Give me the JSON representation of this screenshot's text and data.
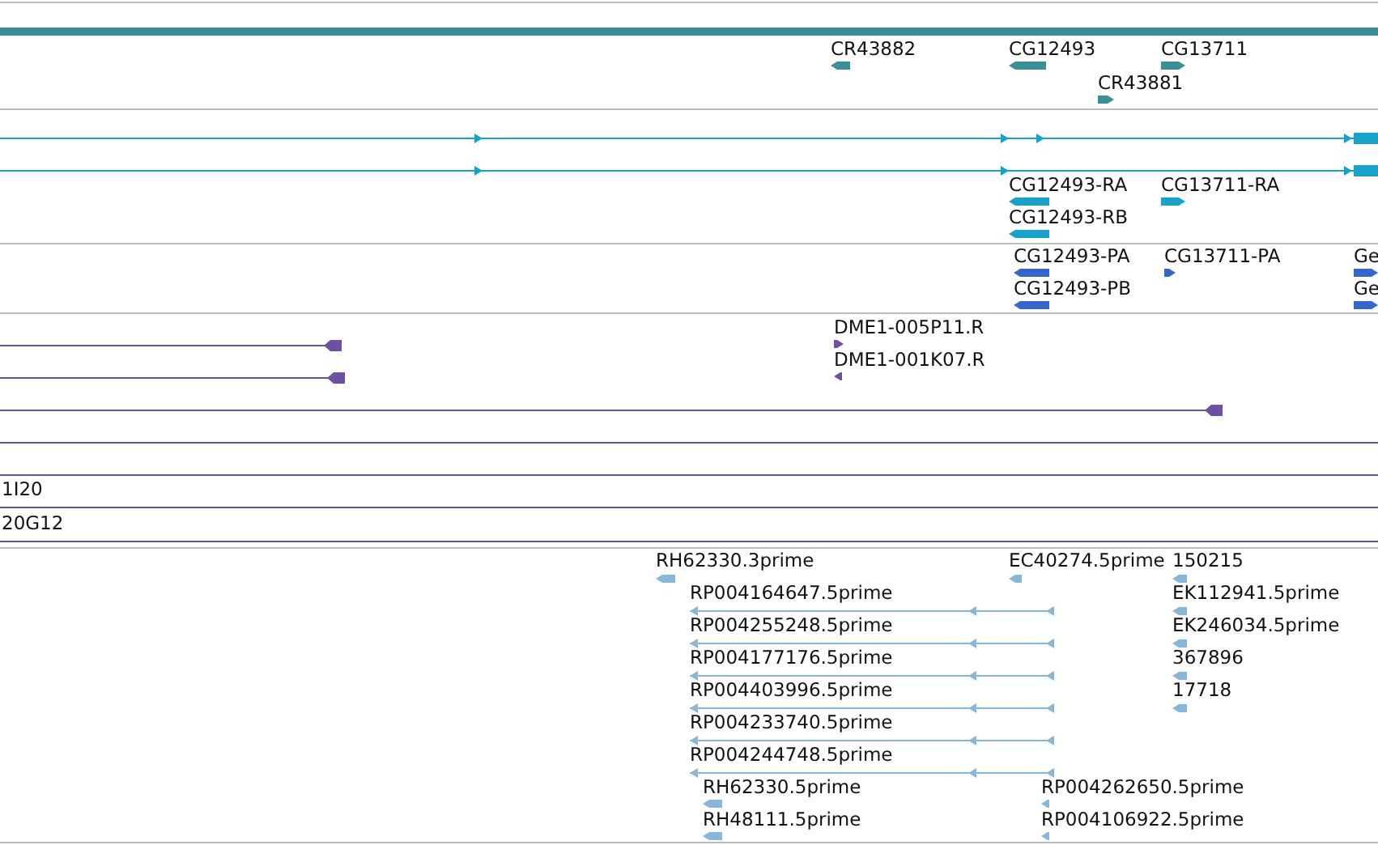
{
  "tracks": [
    {
      "kind": "gene",
      "features": [
        {
          "label": "CR43882",
          "reverse": true
        },
        {
          "label": "CG12493",
          "reverse": true
        },
        {
          "label": "CG13711",
          "reverse": false
        },
        {
          "label": "CR43881",
          "reverse": false
        }
      ]
    },
    {
      "kind": "transcript",
      "features": [
        {
          "label": "CG12493-RA",
          "reverse": true
        },
        {
          "label": "CG13711-RA",
          "reverse": false
        },
        {
          "label": "CG12493-RB",
          "reverse": true
        }
      ]
    },
    {
      "kind": "protein",
      "features": [
        {
          "label": "CG12493-PA",
          "reverse": true
        },
        {
          "label": "CG13711-PA",
          "reverse": false
        },
        {
          "label": "Ge",
          "reverse": false
        },
        {
          "label": "CG12493-PB",
          "reverse": true
        },
        {
          "label": "Ge",
          "reverse": false
        }
      ]
    },
    {
      "kind": "clone",
      "features": [
        {
          "label": "DME1-005P11.R",
          "reverse": false
        },
        {
          "label": "DME1-001K07.R",
          "reverse": true
        },
        {
          "label": "1I20"
        },
        {
          "label": "20G12"
        }
      ]
    },
    {
      "kind": "est",
      "features": [
        {
          "label": "RH62330.3prime",
          "reverse": true
        },
        {
          "label": "EC40274.5prime",
          "reverse": true
        },
        {
          "label": "150215",
          "reverse": true
        },
        {
          "label": "RP004164647.5prime",
          "reverse": true
        },
        {
          "label": "EK112941.5prime",
          "reverse": true
        },
        {
          "label": "RP004255248.5prime",
          "reverse": true
        },
        {
          "label": "EK246034.5prime",
          "reverse": true
        },
        {
          "label": "RP004177176.5prime",
          "reverse": true
        },
        {
          "label": "367896",
          "reverse": true
        },
        {
          "label": "RP004403996.5prime",
          "reverse": true
        },
        {
          "label": "17718",
          "reverse": true
        },
        {
          "label": "RP004233740.5prime",
          "reverse": true
        },
        {
          "label": "RP004244748.5prime",
          "reverse": true
        },
        {
          "label": "RH62330.5prime",
          "reverse": true
        },
        {
          "label": "RP004262650.5prime",
          "reverse": true
        },
        {
          "label": "RH48111.5prime",
          "reverse": true
        },
        {
          "label": "RP004106922.5prime",
          "reverse": true
        }
      ]
    }
  ]
}
